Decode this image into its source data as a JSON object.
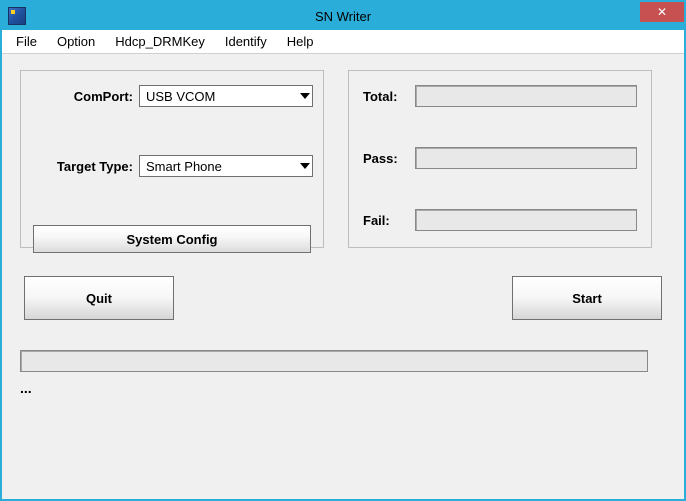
{
  "window": {
    "title": "SN Writer"
  },
  "menubar": {
    "file": "File",
    "option": "Option",
    "hdcp": "Hdcp_DRMKey",
    "identify": "Identify",
    "help": "Help"
  },
  "left": {
    "comport_label": "ComPort:",
    "comport_value": "USB VCOM",
    "target_label": "Target Type:",
    "target_value": "Smart Phone",
    "sysconfig_label": "System Config"
  },
  "right": {
    "total_label": "Total:",
    "total_value": "",
    "pass_label": "Pass:",
    "pass_value": "",
    "fail_label": "Fail:",
    "fail_value": ""
  },
  "buttons": {
    "quit": "Quit",
    "start": "Start"
  },
  "status_text": "..."
}
